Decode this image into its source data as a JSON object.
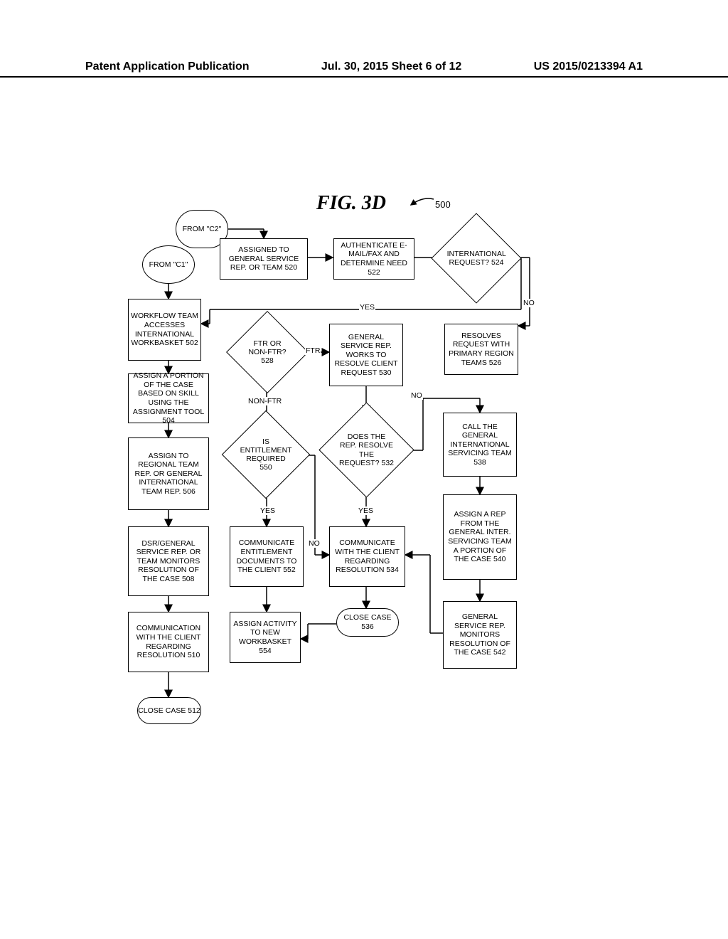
{
  "header": {
    "left": "Patent Application Publication",
    "center": "Jul. 30, 2015  Sheet 6 of 12",
    "right": "US 2015/0213394 A1"
  },
  "figure": {
    "label": "FIG. 3D",
    "ref": "500"
  },
  "connectors": {
    "c1": "FROM \"C1\"",
    "c2": "FROM \"C2\""
  },
  "nodes": {
    "n502": "WORKFLOW TEAM ACCESSES INTERNATIONAL WORKBASKET 502",
    "n504": "ASSIGN A PORTION OF THE CASE BASED ON SKILL USING THE ASSIGNMENT TOOL 504",
    "n506": "ASSIGN TO REGIONAL TEAM REP. OR GENERAL INTERNATIONAL TEAM REP. 506",
    "n508": "DSR/GENERAL SERVICE REP. OR TEAM MONITORS RESOLUTION OF THE CASE 508",
    "n510": "COMMUNICATION WITH THE CLIENT REGARDING RESOLUTION 510",
    "n512": "CLOSE CASE 512",
    "n520": "ASSIGNED TO GENERAL SERVICE REP. OR TEAM 520",
    "n522": "AUTHENTICATE E-MAIL/FAX AND DETERMINE NEED 522",
    "n524": "INTERNATIONAL REQUEST? 524",
    "n526": "RESOLVES REQUEST WITH PRIMARY REGION TEAMS 526",
    "n528": "FTR OR NON-FTR? 528",
    "n530": "GENERAL SERVICE REP. WORKS TO RESOLVE CLIENT REQUEST 530",
    "n532": "DOES THE REP. RESOLVE THE REQUEST? 532",
    "n534": "COMMUNICATE WITH THE CLIENT REGARDING RESOLUTION 534",
    "n536": "CLOSE CASE 536",
    "n538": "CALL THE GENERAL INTERNATIONAL SERVICING TEAM 538",
    "n540": "ASSIGN A REP FROM THE GENERAL INTER. SERVICING TEAM A PORTION OF THE CASE 540",
    "n542": "GENERAL SERVICE REP. MONITORS RESOLUTION OF THE CASE 542",
    "n550": "IS ENTITLEMENT REQUIRED 550",
    "n552": "COMMUNICATE ENTITLEMENT DOCUMENTS TO THE CLIENT 552",
    "n554": "ASSIGN ACTIVITY TO NEW WORKBASKET 554"
  },
  "edges": {
    "yes_524": "YES",
    "no_524": "NO",
    "ftr": "FTR",
    "nonftr": "NON-FTR",
    "yes_532": "YES",
    "no_532": "NO",
    "yes_550": "YES",
    "no_550": "NO"
  }
}
